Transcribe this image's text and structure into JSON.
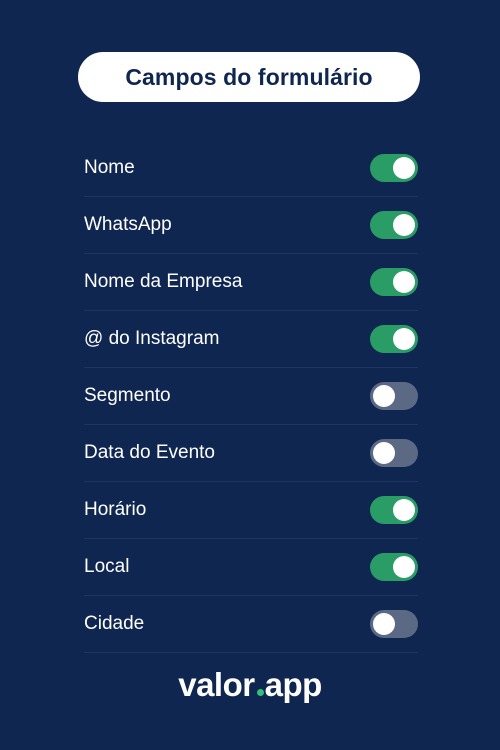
{
  "title": "Campos do formulário",
  "colors": {
    "background": "#0f2650",
    "toggle_on": "#2a9d66",
    "toggle_off": "#5b6985",
    "accent": "#33c17a"
  },
  "fields": [
    {
      "label": "Nome",
      "enabled": true
    },
    {
      "label": "WhatsApp",
      "enabled": true
    },
    {
      "label": "Nome da Empresa",
      "enabled": true
    },
    {
      "label": "@ do Instagram",
      "enabled": true
    },
    {
      "label": "Segmento",
      "enabled": false
    },
    {
      "label": "Data do Evento",
      "enabled": false
    },
    {
      "label": "Horário",
      "enabled": true
    },
    {
      "label": "Local",
      "enabled": true
    },
    {
      "label": "Cidade",
      "enabled": false
    }
  ],
  "brand": {
    "name_part1": "valor",
    "name_part2": "app"
  }
}
